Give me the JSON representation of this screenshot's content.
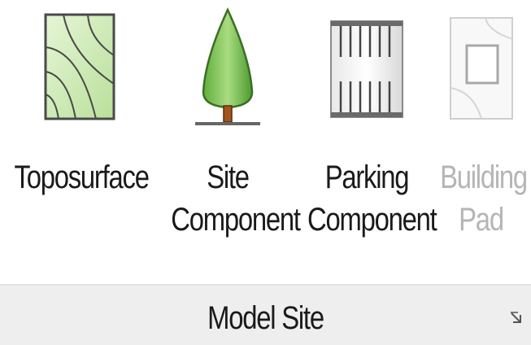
{
  "panel": {
    "title": "Model Site",
    "launcher_icon": "dialog-launcher-arrow-icon"
  },
  "tools": [
    {
      "id": "toposurface",
      "label_lines": [
        "Toposurface"
      ],
      "icon": "toposurface-icon",
      "enabled": true
    },
    {
      "id": "site-component",
      "label_lines": [
        "Site",
        "Component"
      ],
      "icon": "tree-icon",
      "enabled": true
    },
    {
      "id": "parking-component",
      "label_lines": [
        "Parking",
        "Component"
      ],
      "icon": "parking-icon",
      "enabled": true
    },
    {
      "id": "building-pad",
      "label_lines": [
        "Building",
        "Pad"
      ],
      "icon": "building-pad-icon",
      "enabled": false
    }
  ],
  "colors": {
    "disabled_text": "#b5b5b5",
    "footer_bg": "#eeeeee",
    "topo_fill": "#cfe9b4",
    "tree_green": "#7cc05a"
  }
}
